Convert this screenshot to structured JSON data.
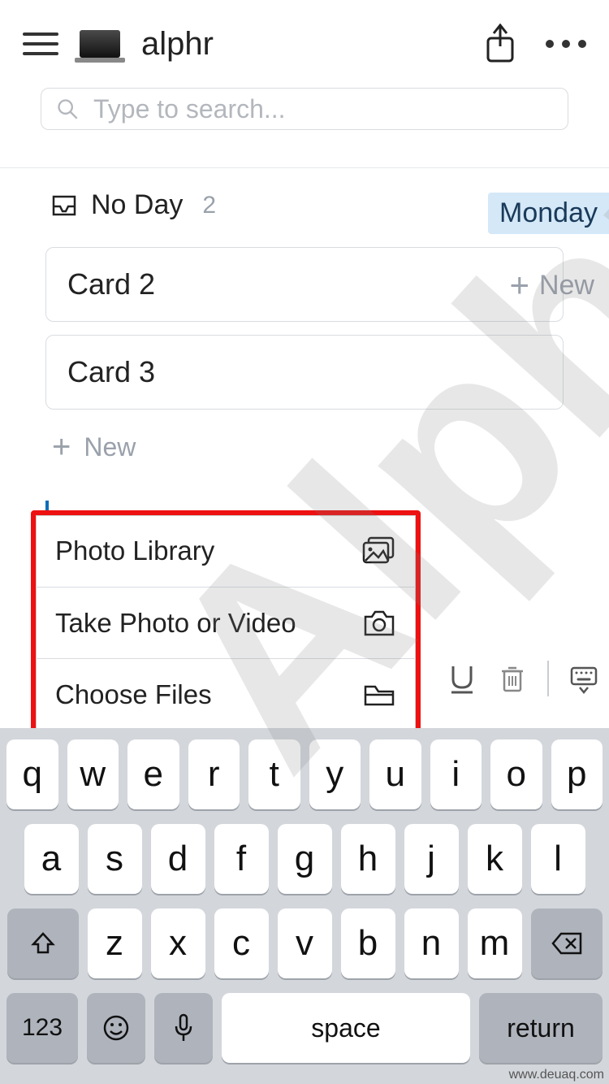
{
  "header": {
    "title": "alphr"
  },
  "search": {
    "placeholder": "Type to search..."
  },
  "section": {
    "label": "No Day",
    "count": "2",
    "day_chip": "Monday"
  },
  "cards": [
    {
      "title": "Card 2"
    },
    {
      "title": "Card 3"
    }
  ],
  "new_label": "New",
  "side_new_label": "New",
  "popup": {
    "items": [
      {
        "label": "Photo Library",
        "icon": "photos-icon"
      },
      {
        "label": "Take Photo or Video",
        "icon": "camera-icon"
      },
      {
        "label": "Choose Files",
        "icon": "folder-icon"
      }
    ]
  },
  "keyboard": {
    "row1": [
      "q",
      "w",
      "e",
      "r",
      "t",
      "y",
      "u",
      "i",
      "o",
      "p"
    ],
    "row2": [
      "a",
      "s",
      "d",
      "f",
      "g",
      "h",
      "j",
      "k",
      "l"
    ],
    "row3": [
      "z",
      "x",
      "c",
      "v",
      "b",
      "n",
      "m"
    ],
    "numbers": "123",
    "space": "space",
    "return": "return"
  },
  "watermark_text": "Alphr",
  "credit": "www.deuaq.com"
}
